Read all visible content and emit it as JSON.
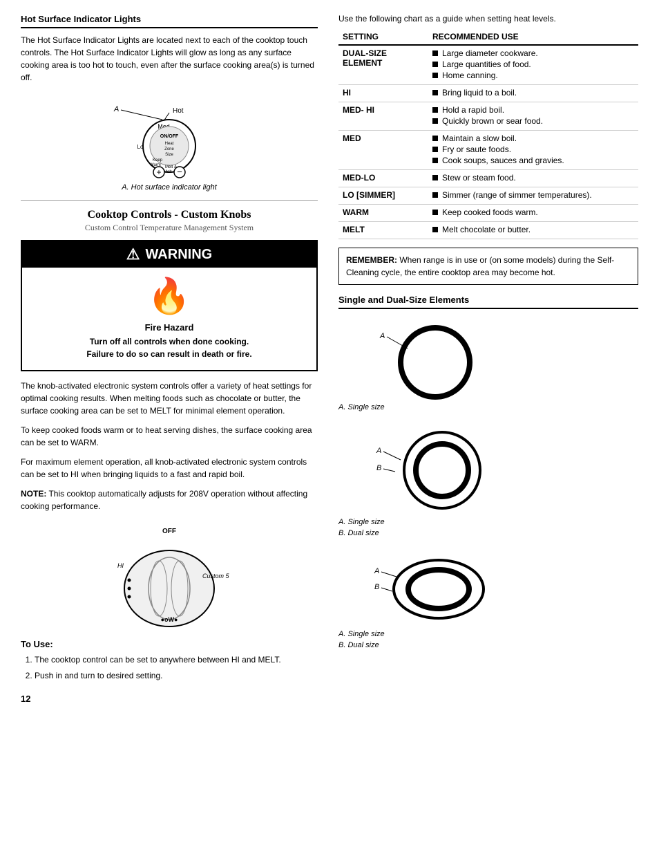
{
  "page": {
    "number": "12"
  },
  "left": {
    "hot_surface_section": {
      "title": "Hot Surface Indicator Lights",
      "body1": "The Hot Surface Indicator Lights are located next to each of the cooktop touch controls. The Hot Surface Indicator Lights will glow as long as any surface cooking area is too hot to touch, even after the surface cooking area(s) is turned off.",
      "diagram_label": "A",
      "diagram_sublabel": "Hot",
      "diagram_caption": "A. Hot surface indicator light"
    },
    "cooktop_section": {
      "heading": "Cooktop Controls - Custom Knobs",
      "subheading": "Custom Control Temperature Management System"
    },
    "warning": {
      "header": "WARNING",
      "fire_hazard": "Fire Hazard",
      "line1": "Turn off all controls when done cooking.",
      "line2": "Failure to do so can result in death or fire."
    },
    "body2": "The knob-activated electronic system controls offer a variety of heat settings for optimal cooking results. When melting foods such as chocolate or butter, the surface cooking area can be set to MELT for minimal element operation.",
    "body3": "To keep cooked foods warm or to heat serving dishes, the surface cooking area can be set to WARM.",
    "body4": "For maximum element operation, all knob-activated electronic system controls can be set to HI when bringing liquids to a fast and rapid boil.",
    "note": "NOTE: This cooktop automatically adjusts for 208V operation without affecting cooking performance.",
    "to_use": {
      "title": "To Use:",
      "steps": [
        "The cooktop control can be set to anywhere between HI and MELT.",
        "Push in and turn to desired setting."
      ]
    }
  },
  "right": {
    "guide_text": "Use the following chart as a guide when setting heat levels.",
    "table": {
      "col1_header": "SETTING",
      "col2_header": "RECOMMENDED USE",
      "rows": [
        {
          "setting": "DUAL-SIZE ELEMENT",
          "uses": [
            "Large diameter cookware.",
            "Large quantities of food.",
            "Home canning."
          ]
        },
        {
          "setting": "HI",
          "uses": [
            "Bring liquid to a boil."
          ]
        },
        {
          "setting": "MED- HI",
          "uses": [
            "Hold a rapid boil.",
            "Quickly brown or sear food."
          ]
        },
        {
          "setting": "MED",
          "uses": [
            "Maintain a slow boil.",
            "Fry or saute foods.",
            "Cook soups, sauces and gravies."
          ]
        },
        {
          "setting": "MED-LO",
          "uses": [
            "Stew or steam food."
          ]
        },
        {
          "setting": "LO [SIMMER]",
          "uses": [
            "Simmer (range of simmer temperatures)."
          ]
        },
        {
          "setting": "WARM",
          "uses": [
            "Keep cooked foods warm."
          ]
        },
        {
          "setting": "MELT",
          "uses": [
            "Melt chocolate or butter."
          ]
        }
      ]
    },
    "remember_box": {
      "bold": "REMEMBER:",
      "text": " When range is in use or (on some models) during the Self-Cleaning cycle, the entire cooktop area may become hot."
    },
    "dual_size_section": {
      "title": "Single and Dual-Size Elements",
      "diagrams": [
        {
          "label_a": "A",
          "caption": "A. Single size"
        },
        {
          "label_a": "A",
          "label_b": "B",
          "caption1": "A. Single size",
          "caption2": "B. Dual size"
        },
        {
          "label_a": "A",
          "label_b": "B",
          "caption1": "A. Single size",
          "caption2": "B. Dual size"
        }
      ]
    }
  }
}
